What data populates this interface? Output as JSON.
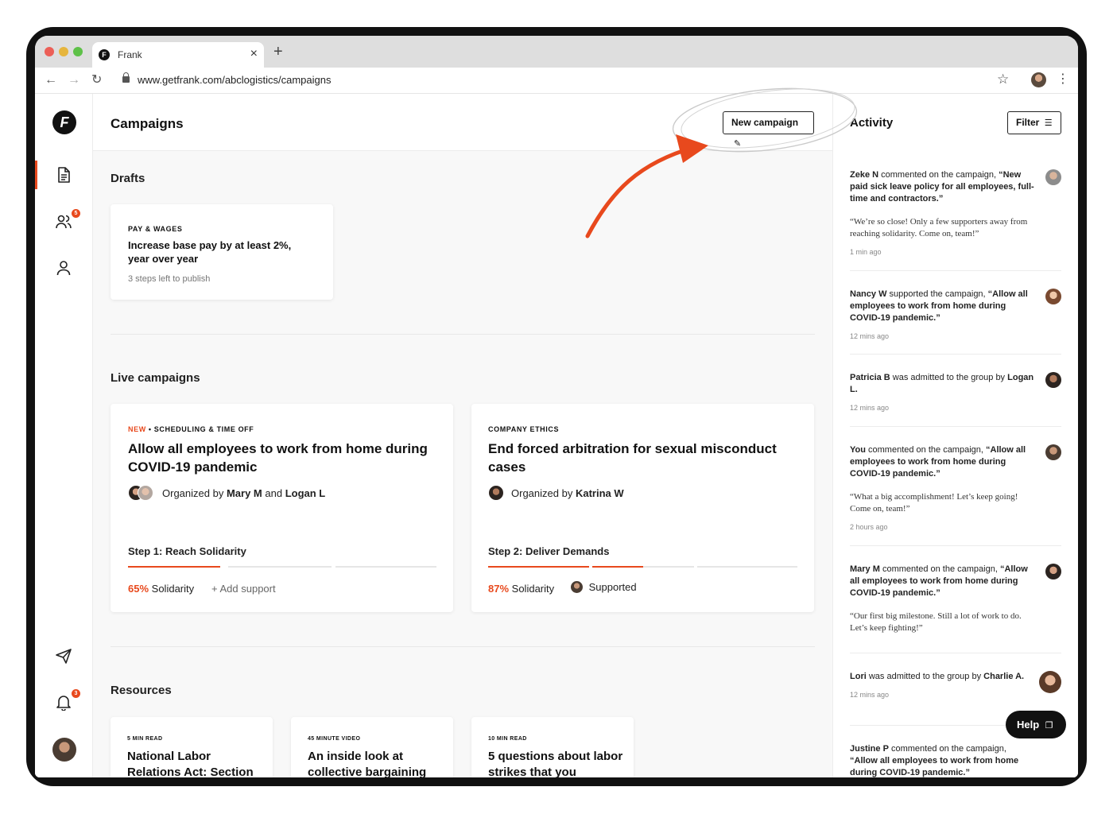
{
  "browser": {
    "tab_title": "Frank",
    "url": "www.getfrank.com/abclogistics/campaigns"
  },
  "sidebar": {
    "logo_letter": "F",
    "people_badge": "5",
    "notifications_badge": "3"
  },
  "main": {
    "page_title": "Campaigns",
    "new_campaign_label": "New campaign",
    "drafts": {
      "title": "Drafts",
      "items": [
        {
          "category": "PAY & WAGES",
          "title": "Increase base pay by at least 2%, year over year",
          "status": "3 steps left to publish"
        }
      ]
    },
    "live": {
      "title": "Live campaigns",
      "items": [
        {
          "new_label": "NEW",
          "category": "SCHEDULING & TIME OFF",
          "title": "Allow all employees to work from home during COVID-19 pandemic",
          "organized_prefix": "Organized by",
          "organizer_1": "Mary M",
          "joiner": "and",
          "organizer_2": "Logan L",
          "step": "Step 1: Reach Solidarity",
          "progress_segments_done": 1,
          "progress_segments_total": 3,
          "percent": "65%",
          "percent_label": "Solidarity",
          "action_label": "Add support"
        },
        {
          "category": "COMPANY ETHICS",
          "title": "End forced arbitration for sexual misconduct cases",
          "organized_prefix": "Organized by",
          "organizer_1": "Katrina W",
          "step": "Step 2: Deliver Demands",
          "progress_segments_done": 2,
          "progress_segments_total": 4,
          "percent": "87%",
          "percent_label": "Solidarity",
          "supported_label": "Supported"
        }
      ]
    },
    "resources": {
      "title": "Resources",
      "items": [
        {
          "eyebrow": "5 MIN READ",
          "title": "National Labor Relations Act: Section"
        },
        {
          "eyebrow": "45 MINUTE VIDEO",
          "title": "An inside look at collective bargaining"
        },
        {
          "eyebrow": "10 MIN READ",
          "title": "5 questions about labor strikes that you"
        }
      ]
    }
  },
  "activity": {
    "title": "Activity",
    "filter_label": "Filter",
    "items": [
      {
        "actor": "Zeke N",
        "action": " commented on the campaign, ",
        "object": "“New paid sick leave policy for all employees, full-time and contractors.”",
        "quote": "“We’re so close! Only a few supporters away from reaching solidarity. Come on, team!”",
        "time": "1 min ago"
      },
      {
        "actor": "Nancy W",
        "action": " supported the campaign, ",
        "object": "“Allow all employees to work from home during COVID-19 pandemic.”",
        "quote": "",
        "time": "12 mins ago"
      },
      {
        "actor": "Patricia B",
        "action": " was admitted to the group by ",
        "object": "Logan L.",
        "quote": "",
        "time": "12 mins ago"
      },
      {
        "actor": "You",
        "action": " commented on the campaign, ",
        "object": "“Allow all employees to work from home during COVID-19 pandemic.”",
        "quote": "“What a big accomplishment! Let’s keep going! Come on, team!”",
        "time": "2 hours ago"
      },
      {
        "actor": "Mary M",
        "action": " commented on the campaign, ",
        "object": "“Allow all employees to work from home during COVID-19 pandemic.”",
        "quote": "“Our first big milestone. Still a lot of work to do. Let’s keep fighting!”",
        "time": ""
      },
      {
        "actor": "Lori",
        "action": " was admitted to the group by ",
        "object": "Charlie A.",
        "quote": "",
        "time": "12 mins ago"
      },
      {
        "actor": "Justine P",
        "action": " commented on the campaign, ",
        "object": "“Allow all employees to work from home during COVID-19 pandemic.”",
        "quote": "",
        "time": ""
      }
    ]
  },
  "help_label": "Help",
  "colors": {
    "accent": "#e8491d",
    "ink": "#111111"
  }
}
